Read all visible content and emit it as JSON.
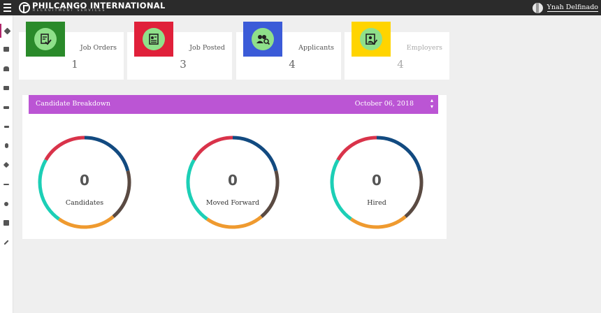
{
  "header": {
    "brand_title": "PHILCANGO INTERNATIONAL",
    "brand_subtitle": "RECRUITMENT SERVICES",
    "user_name": "Ynah Delfinado"
  },
  "sidebar": {
    "items": [
      {
        "icon": "pin-icon",
        "active": true
      },
      {
        "icon": "edit-icon"
      },
      {
        "icon": "stamp-icon"
      },
      {
        "icon": "id-card-icon"
      },
      {
        "icon": "bed-icon"
      },
      {
        "icon": "hammer-icon"
      },
      {
        "icon": "worker-icon"
      },
      {
        "icon": "heart-icon"
      },
      {
        "icon": "plane-icon"
      },
      {
        "icon": "hand-icon"
      },
      {
        "icon": "building-icon"
      },
      {
        "icon": "wrench-icon"
      }
    ]
  },
  "stats": [
    {
      "label": "Job Orders",
      "value": "1",
      "color": "#2a8a2a",
      "icon": "job-orders-icon"
    },
    {
      "label": "Job Posted",
      "value": "3",
      "color": "#e0203a",
      "icon": "job-posted-icon"
    },
    {
      "label": "Applicants",
      "value": "4",
      "color": "#3b5bd8",
      "icon": "applicants-icon"
    },
    {
      "label": "Employers",
      "value": "4",
      "color": "#ffd400",
      "icon": "employers-icon"
    }
  ],
  "breakdown": {
    "title": "Candidate Breakdown",
    "date": "October 06, 2018",
    "header_color": "#bb55d4",
    "segment_colors": [
      "#d9334a",
      "#124a80",
      "#5a4a42",
      "#ef9a2f",
      "#1ccfb6"
    ],
    "donuts": [
      {
        "value": "0",
        "label": "Candidates"
      },
      {
        "value": "0",
        "label": "Moved Forward"
      },
      {
        "value": "0",
        "label": "Hired"
      }
    ]
  }
}
